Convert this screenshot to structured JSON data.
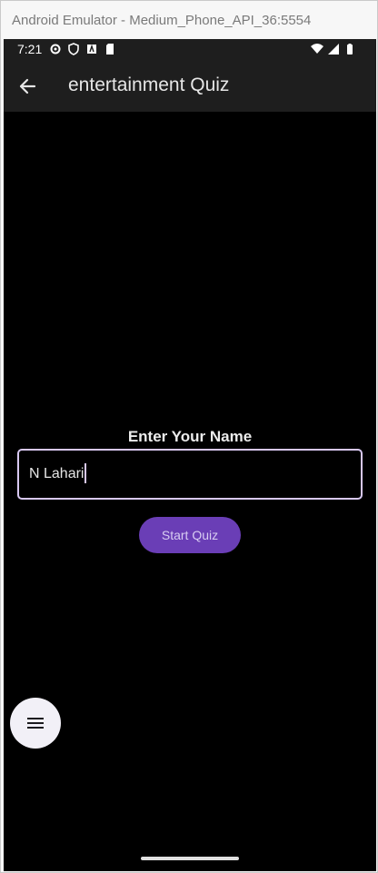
{
  "window": {
    "title": "Android Emulator - Medium_Phone_API_36:5554"
  },
  "statusbar": {
    "time": "7:21",
    "left_icons": [
      "settings-icon",
      "shield-icon",
      "text-icon",
      "sd-card-icon"
    ],
    "right_icons": [
      "wifi-icon",
      "signal-icon",
      "battery-icon"
    ]
  },
  "appbar": {
    "title": "entertainment Quiz",
    "back_icon": "arrow-left-icon"
  },
  "form": {
    "prompt": "Enter Your Name",
    "name_value": "N Lahari",
    "start_label": "Start Quiz"
  },
  "fab": {
    "icon": "menu-icon"
  },
  "colors": {
    "accent": "#6a3eb6",
    "field_border": "#d8c8f2",
    "background": "#000000",
    "bar": "#1e1e1e"
  }
}
